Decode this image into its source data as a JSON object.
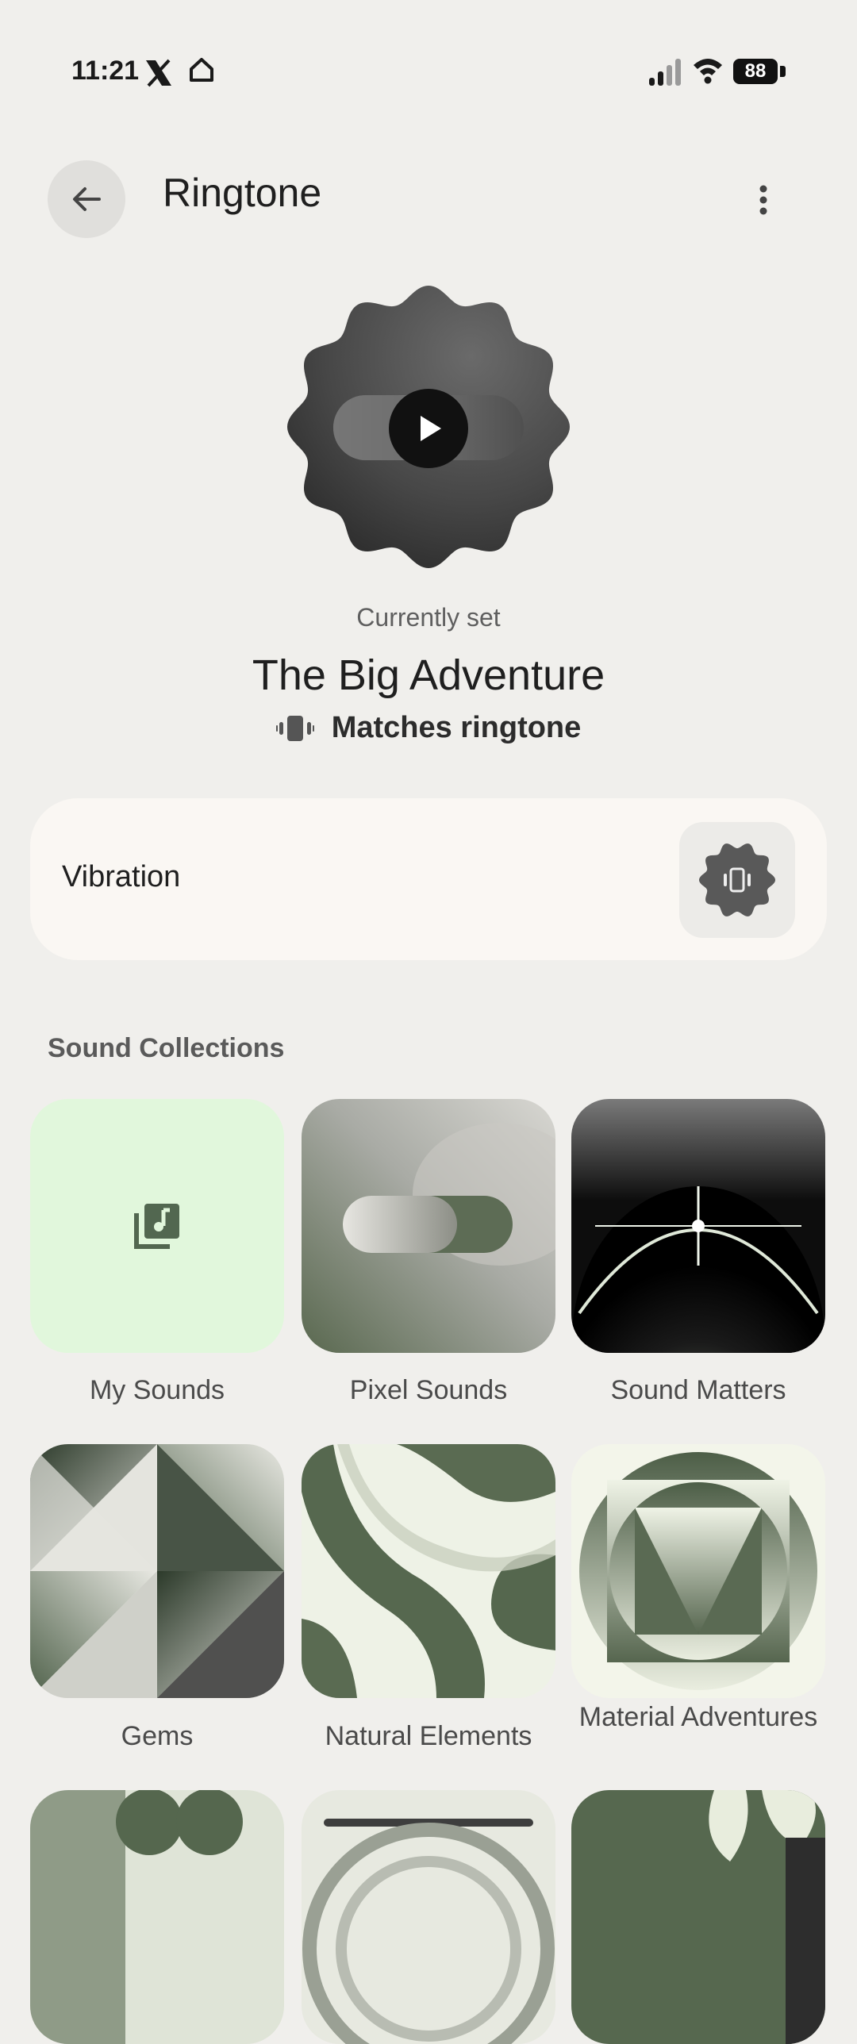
{
  "status": {
    "time": "11:21",
    "battery": "88"
  },
  "header": {
    "title": "Ringtone"
  },
  "preview": {
    "caption": "Currently set",
    "name": "The Big Adventure",
    "vibration_match": "Matches ringtone"
  },
  "vibration": {
    "label": "Vibration"
  },
  "collections": {
    "title": "Sound Collections",
    "items": [
      {
        "label": "My Sounds"
      },
      {
        "label": "Pixel Sounds"
      },
      {
        "label": "Sound Matters"
      },
      {
        "label": "Gems"
      },
      {
        "label": "Natural Elements"
      },
      {
        "label": "Material Adventures"
      }
    ]
  },
  "colors": {
    "accent_green": "#526750",
    "tile_light_green": "#e1f7dc",
    "background": "#f0efec"
  }
}
